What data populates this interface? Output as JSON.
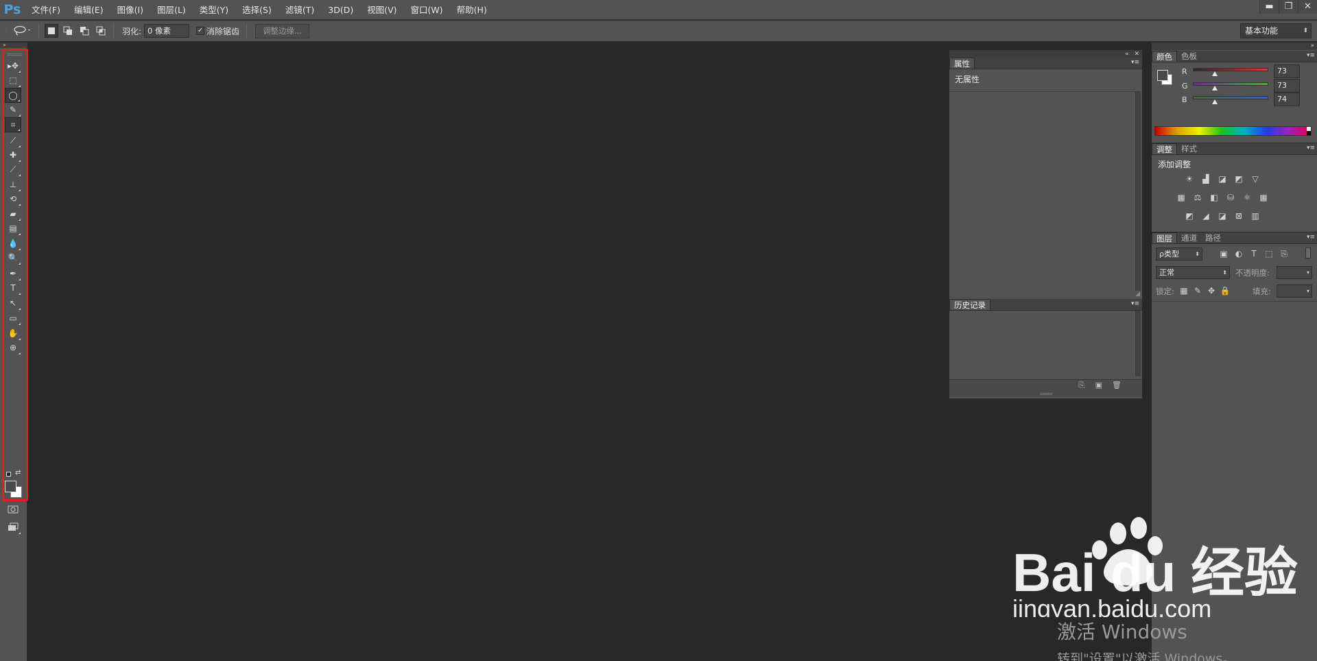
{
  "app": {
    "logo": "Ps"
  },
  "menubar": {
    "items": [
      "文件(F)",
      "编辑(E)",
      "图像(I)",
      "图层(L)",
      "类型(Y)",
      "选择(S)",
      "滤镜(T)",
      "3D(D)",
      "视图(V)",
      "窗口(W)",
      "帮助(H)"
    ]
  },
  "window_controls": {
    "minimize": "▬",
    "restore": "❐",
    "close": "✕"
  },
  "optionsbar": {
    "feather_label": "羽化:",
    "feather_value": "0 像素",
    "antialias_checked_mark": "✓",
    "antialias_label": "消除锯齿",
    "refine_edge_label": "调整边缘...",
    "workspace_value": "基本功能"
  },
  "toolbox": {
    "highlight_color": "#e02020",
    "tools": [
      {
        "name": "move-tool-icon",
        "glyph": "▸✥",
        "active": false
      },
      {
        "name": "marquee-tool-icon",
        "glyph": "⬚",
        "active": false
      },
      {
        "name": "lasso-tool-icon",
        "glyph": "◯",
        "active": true
      },
      {
        "name": "quick-selection-tool-icon",
        "glyph": "✎",
        "active": false
      },
      {
        "name": "crop-tool-icon",
        "glyph": "⌗",
        "active": true
      },
      {
        "name": "eyedropper-tool-icon",
        "glyph": "⟋",
        "active": false
      },
      {
        "name": "healing-brush-tool-icon",
        "glyph": "✚",
        "active": false
      },
      {
        "name": "brush-tool-icon",
        "glyph": "⟋",
        "active": false
      },
      {
        "name": "clone-stamp-tool-icon",
        "glyph": "⊥",
        "active": false
      },
      {
        "name": "history-brush-tool-icon",
        "glyph": "⟲",
        "active": false
      },
      {
        "name": "eraser-tool-icon",
        "glyph": "▰",
        "active": false
      },
      {
        "name": "gradient-tool-icon",
        "glyph": "▤",
        "active": false
      },
      {
        "name": "blur-tool-icon",
        "glyph": "💧",
        "active": false
      },
      {
        "name": "dodge-tool-icon",
        "glyph": "🔍",
        "active": false
      },
      {
        "name": "pen-tool-icon",
        "glyph": "✒",
        "active": false
      },
      {
        "name": "type-tool-icon",
        "glyph": "T",
        "active": false
      },
      {
        "name": "path-selection-tool-icon",
        "glyph": "↖",
        "active": false
      },
      {
        "name": "rectangle-tool-icon",
        "glyph": "▭",
        "active": false
      },
      {
        "name": "hand-tool-icon",
        "glyph": "✋",
        "active": false
      },
      {
        "name": "zoom-tool-icon",
        "glyph": "⊕",
        "active": false
      }
    ]
  },
  "properties_panel": {
    "tab": "属性",
    "content": "无属性"
  },
  "history_panel": {
    "tab": "历史记录"
  },
  "color_panel": {
    "tabs": [
      "颜色",
      "色板"
    ],
    "channels": [
      {
        "label": "R",
        "value": "73",
        "fraction": 0.29,
        "color_from": "#2a2a2a",
        "color_to": "#e03838"
      },
      {
        "label": "G",
        "value": "73",
        "fraction": 0.29,
        "color_from": "#7a20a0",
        "color_to": "#30c030"
      },
      {
        "label": "B",
        "value": "74",
        "fraction": 0.29,
        "color_from": "#4a6a20",
        "color_to": "#3060e0"
      }
    ]
  },
  "adjustments_panel": {
    "tabs": [
      "调整",
      "样式"
    ],
    "title": "添加调整"
  },
  "layers_panel": {
    "tabs": [
      "图层",
      "通道",
      "路径"
    ],
    "filter_label": "ρ类型",
    "blend_mode": "正常",
    "opacity_label": "不透明度:",
    "lock_label": "锁定:",
    "fill_label": "填充:"
  },
  "watermarks": {
    "baidu_logo": "Bai du 经验",
    "baidu_url": "jingyan.baidu.com",
    "activate_line1": "激活 Windows",
    "activate_line2": "转到\"设置\"以激活 Windows。"
  }
}
